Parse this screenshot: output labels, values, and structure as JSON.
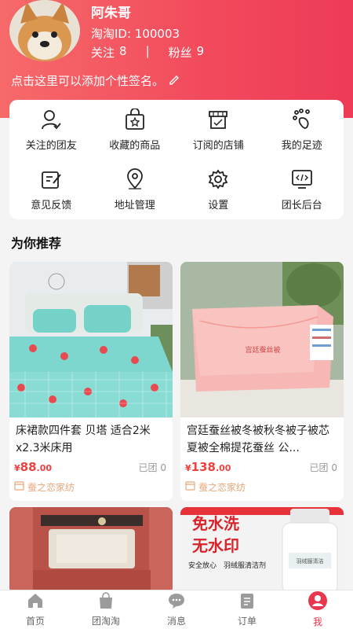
{
  "profile": {
    "username": "阿朱哥",
    "user_id": "淘淘ID: 100003",
    "following_label": "关注",
    "following_count": "8",
    "separator": "|",
    "fans_label": "粉丝",
    "fans_count": "9",
    "signature": "点击这里可以添加个性签名。"
  },
  "menu": [
    {
      "label": "关注的团友",
      "icon": "user-check-icon"
    },
    {
      "label": "收藏的商品",
      "icon": "star-bag-icon"
    },
    {
      "label": "订阅的店铺",
      "icon": "store-icon"
    },
    {
      "label": "我的足迹",
      "icon": "footprint-icon"
    },
    {
      "label": "意见反馈",
      "icon": "feedback-icon"
    },
    {
      "label": "地址管理",
      "icon": "location-pin-icon"
    },
    {
      "label": "设置",
      "icon": "gear-icon"
    },
    {
      "label": "团长后台",
      "icon": "code-monitor-icon"
    }
  ],
  "recommend": {
    "title": "为你推荐",
    "products": [
      {
        "title": "床裙款四件套 贝塔 适合2米x2.3米床用",
        "price_symbol": "¥",
        "price_int": "88",
        "price_dec": ".00",
        "sold": "已团 0",
        "shop": "蚕之恋家纺"
      },
      {
        "title": "宫廷蚕丝被冬被秋冬被子被芯夏被全棉提花蚕丝 公...",
        "price_symbol": "¥",
        "price_int": "138",
        "price_dec": ".00",
        "sold": "已团 0",
        "shop": "蚕之恋家纺",
        "label_on_item": "宫廷蚕丝被"
      },
      {
        "title": "",
        "shop": ""
      },
      {
        "title": "",
        "banner_line1": "免水洗",
        "banner_line2": "无水印",
        "banner_sub1": "安全放心",
        "banner_sub2": "羽绒服清洁剂",
        "bottle_text": "羽绒服清洁"
      }
    ]
  },
  "tabbar": [
    {
      "label": "首页",
      "icon": "home-icon"
    },
    {
      "label": "团淘淘",
      "icon": "shopping-bag-icon"
    },
    {
      "label": "消息",
      "icon": "message-icon"
    },
    {
      "label": "订单",
      "icon": "order-list-icon"
    },
    {
      "label": "我",
      "icon": "profile-icon",
      "active": true
    }
  ],
  "colors": {
    "brand": "#f2495c",
    "price": "#f04040",
    "shop": "#e9a67a"
  }
}
